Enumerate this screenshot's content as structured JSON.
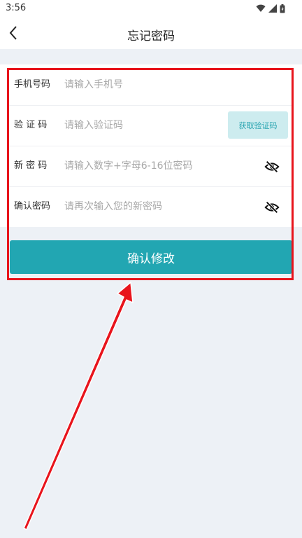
{
  "status_bar": {
    "time": "3:56",
    "icons": [
      "wifi-icon",
      "signal-icon",
      "battery-icon"
    ]
  },
  "nav": {
    "back_icon": "chevron-left-icon",
    "title": "忘记密码"
  },
  "form": {
    "phone": {
      "label": "手机号码",
      "placeholder": "请输入手机号",
      "value": ""
    },
    "code": {
      "label": "验 证 码",
      "placeholder": "请输入验证码",
      "value": "",
      "button_label": "获取验证码"
    },
    "new_password": {
      "label": "新 密 码",
      "placeholder": "请输入数字+字母6-16位密码",
      "value": "",
      "toggle_icon": "eye-off-icon"
    },
    "confirm_password": {
      "label": "确认密码",
      "placeholder": "请再次输入您的新密码",
      "value": "",
      "toggle_icon": "eye-off-icon"
    }
  },
  "submit_label": "确认修改",
  "colors": {
    "accent": "#22a6b2",
    "code_button_bg": "#cdecef",
    "page_bg": "#edf1f6",
    "annotation": "#e8141c"
  }
}
